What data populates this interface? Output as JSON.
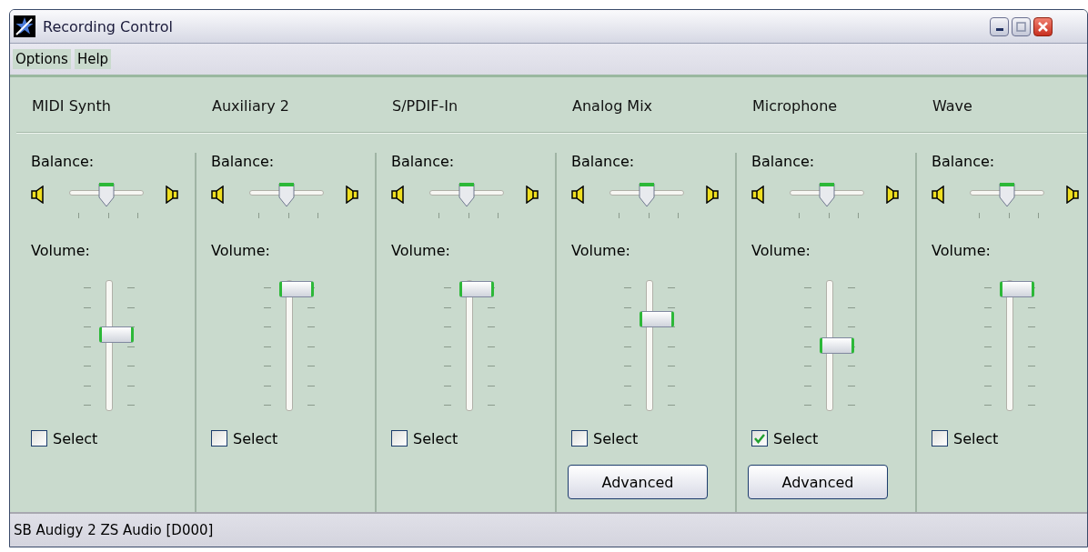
{
  "window": {
    "title": "Recording Control"
  },
  "menu": [
    "Options",
    "Help"
  ],
  "channels": [
    {
      "name": "MIDI Synth",
      "balance_label": "Balance:",
      "balance": {
        "level": 0.5
      },
      "volume_label": "Volume:",
      "volume": {
        "level": 0.6
      },
      "select": {
        "label": "Select",
        "checked": false
      }
    },
    {
      "name": "Auxiliary 2",
      "balance_label": "Balance:",
      "balance": {
        "level": 0.5
      },
      "volume_label": "Volume:",
      "volume": {
        "level": 1
      },
      "select": {
        "label": "Select",
        "checked": false
      }
    },
    {
      "name": "S/PDIF-In",
      "balance_label": "Balance:",
      "balance": {
        "level": 0.5
      },
      "volume_label": "Volume:",
      "volume": {
        "level": 1
      },
      "select": {
        "label": "Select",
        "checked": false
      }
    },
    {
      "name": "Analog Mix",
      "balance_label": "Balance:",
      "balance": {
        "level": 0.5
      },
      "volume_label": "Volume:",
      "volume": {
        "level": 0.73
      },
      "select": {
        "label": "Select",
        "checked": false
      },
      "advanced": "Advanced"
    },
    {
      "name": "Microphone",
      "balance_label": "Balance:",
      "balance": {
        "level": 0.5
      },
      "volume_label": "Volume:",
      "volume": {
        "level": 0.5
      },
      "select": {
        "label": "Select",
        "checked": true
      },
      "advanced": "Advanced"
    },
    {
      "name": "Wave",
      "balance_label": "Balance:",
      "balance": {
        "level": 0.5
      },
      "volume_label": "Volume:",
      "volume": {
        "level": 1
      },
      "select": {
        "label": "Select",
        "checked": false
      }
    }
  ],
  "status_bar": "SB Audigy 2 ZS Audio [D000]"
}
